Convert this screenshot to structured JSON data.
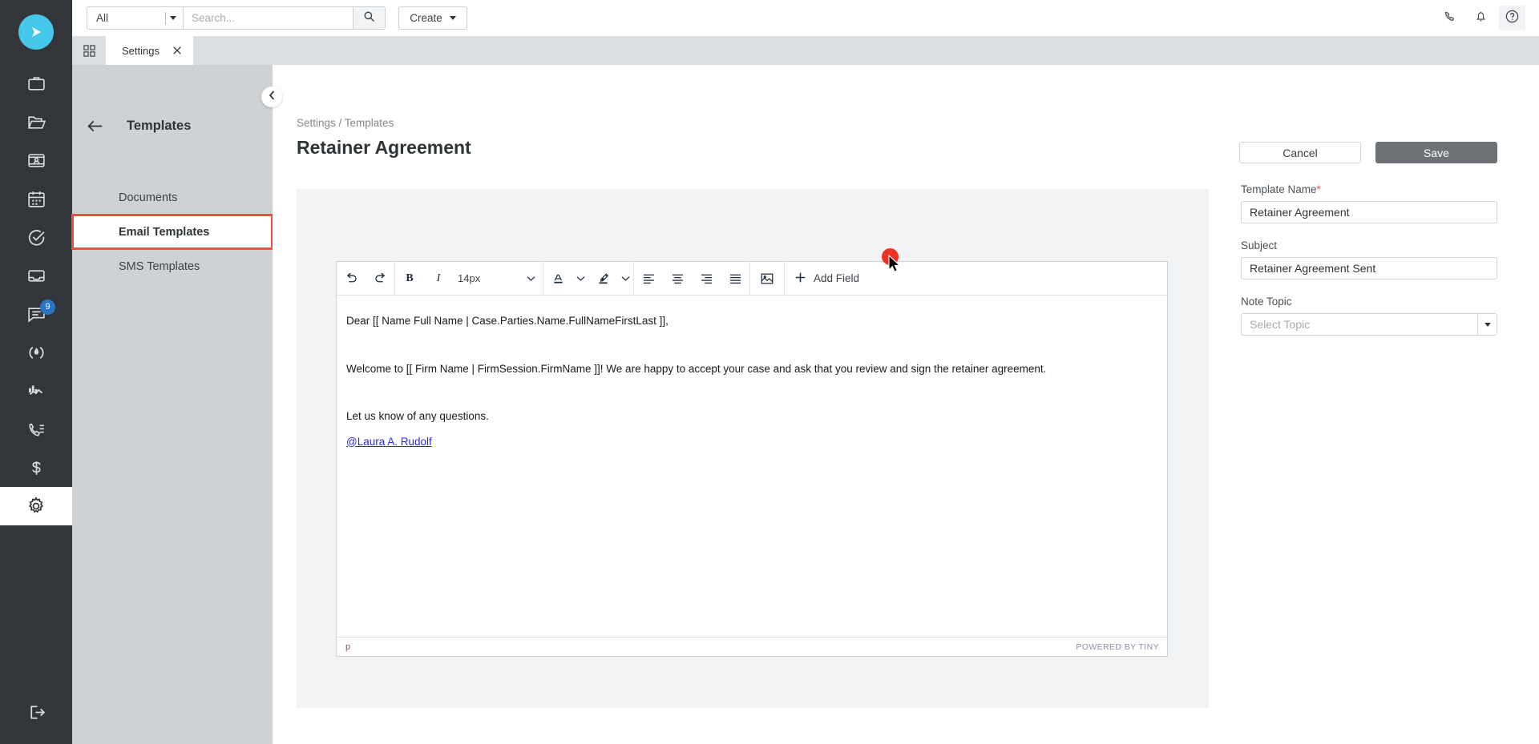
{
  "brand": {
    "accent": "#45c8ea",
    "rail_bg": "#32363a",
    "highlight": "#f04e3e",
    "save_bg": "#6e7276",
    "badge_bg": "#2a74c8"
  },
  "topbar": {
    "scope_value": "All",
    "search_placeholder": "Search...",
    "search_value": "",
    "create_label": "Create",
    "icons": [
      "phone-icon",
      "bell-icon",
      "help-icon"
    ]
  },
  "tabbar": {
    "grid_icon": "grid-icon",
    "tabs": [
      {
        "label": "Settings",
        "active": true,
        "close_icon": "close-icon"
      }
    ]
  },
  "rail": {
    "logo_icon": "play-logo-icon",
    "items": [
      {
        "name": "briefcase-icon",
        "label": "Cases",
        "badge": null,
        "active": false
      },
      {
        "name": "folder-icon",
        "label": "Documents",
        "badge": null,
        "active": false
      },
      {
        "name": "contact-card-icon",
        "label": "Contacts",
        "badge": null,
        "active": false
      },
      {
        "name": "calendar-icon",
        "label": "Calendar",
        "badge": null,
        "active": false
      },
      {
        "name": "check-circle-icon",
        "label": "Tasks",
        "badge": null,
        "active": false
      },
      {
        "name": "inbox-icon",
        "label": "Inbox",
        "badge": null,
        "active": false
      },
      {
        "name": "messages-icon",
        "label": "Messages",
        "badge": "9",
        "active": false
      },
      {
        "name": "intake-icon",
        "label": "Intake",
        "badge": null,
        "active": false
      },
      {
        "name": "reports-icon",
        "label": "Reports",
        "badge": null,
        "active": false
      },
      {
        "name": "call-log-icon",
        "label": "Calls",
        "badge": null,
        "active": false
      },
      {
        "name": "dollar-icon",
        "label": "Billing",
        "badge": null,
        "active": false
      },
      {
        "name": "gear-icon",
        "label": "Settings",
        "badge": null,
        "active": true
      }
    ],
    "logout_icon": "logout-icon"
  },
  "subnav": {
    "back_icon": "arrow-left-icon",
    "title": "Templates",
    "collapse_icon": "chevron-left-icon",
    "items": [
      {
        "label": "Documents",
        "active": false,
        "highlighted": false
      },
      {
        "label": "Email Templates",
        "active": true,
        "highlighted": true
      },
      {
        "label": "SMS Templates",
        "active": false,
        "highlighted": false
      }
    ]
  },
  "main": {
    "breadcrumb": "Settings / Templates",
    "title": "Retainer Agreement",
    "cancel_label": "Cancel",
    "save_label": "Save",
    "fields": {
      "template_name_label": "Template Name",
      "template_name_required": "*",
      "template_name_value": "Retainer Agreement",
      "subject_label": "Subject",
      "subject_value": "Retainer Agreement Sent",
      "note_topic_label": "Note Topic",
      "note_topic_placeholder": "Select Topic"
    }
  },
  "editor": {
    "toolbar": {
      "undo_icon": "undo-icon",
      "redo_icon": "redo-icon",
      "bold_label": "B",
      "italic_label": "I",
      "fontsize_value": "14px",
      "fontsize_chevron": "chevron-down-icon",
      "textcolor_icon": "text-color-icon",
      "textcolor_chevron": "chevron-down-icon",
      "highlight_icon": "highlight-color-icon",
      "highlight_chevron": "chevron-down-icon",
      "align_left_icon": "align-left-icon",
      "align_center_icon": "align-center-icon",
      "align_right_icon": "align-right-icon",
      "align_justify_icon": "align-justify-icon",
      "image_icon": "insert-image-icon",
      "add_field_plus_icon": "plus-icon",
      "add_field_label": "Add Field"
    },
    "body": {
      "line1": "Dear [[ Name Full Name | Case.Parties.Name.FullNameFirstLast ]],",
      "line2": "Welcome to [[ Firm Name | FirmSession.FirmName ]]! We are happy to accept your case and ask that you review and sign the retainer agreement.",
      "line3": "Let us know of any questions.",
      "line4": "@Laura A. Rudolf"
    },
    "status": {
      "path": "p",
      "brand": "POWERED BY TINY"
    }
  }
}
